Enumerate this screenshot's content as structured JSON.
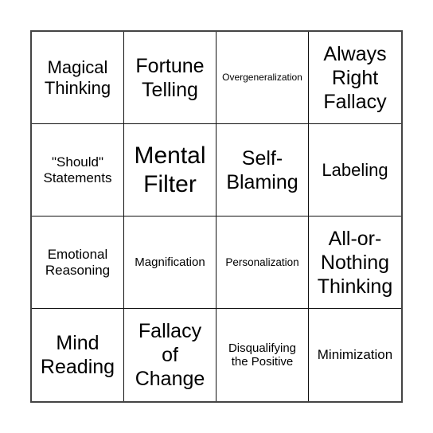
{
  "card": {
    "cells": [
      [
        "Magical Thinking",
        "Fortune Telling",
        "Overgeneralization",
        "Always Right Fallacy"
      ],
      [
        "\"Should\" Statements",
        "Mental Filter",
        "Self-Blaming",
        "Labeling"
      ],
      [
        "Emotional Reasoning",
        "Magnification",
        "Personalization",
        "All-or-Nothing Thinking"
      ],
      [
        "Mind Reading",
        "Fallacy of Change",
        "Disqualifying the Positive",
        "Minimization"
      ]
    ]
  },
  "lines": {
    "magical": [
      "Magical",
      "Thinking"
    ],
    "fortune": [
      "Fortune",
      "Telling"
    ],
    "overgen": [
      "Overgeneralization"
    ],
    "always": [
      "Always",
      "Right",
      "Fallacy"
    ],
    "should": [
      "\"Should\"",
      "Statements"
    ],
    "mental": [
      "Mental",
      "Filter"
    ],
    "self": [
      "Self-",
      "Blaming"
    ],
    "labeling": [
      "Labeling"
    ],
    "emotional": [
      "Emotional",
      "Reasoning"
    ],
    "magnification": [
      "Magnification"
    ],
    "personalization": [
      "Personalization"
    ],
    "allor": [
      "All-or-",
      "Nothing",
      "Thinking"
    ],
    "mind": [
      "Mind",
      "Reading"
    ],
    "fallacy": [
      "Fallacy",
      "of",
      "Change"
    ],
    "disq": [
      "Disqualifying",
      "the Positive"
    ],
    "minimization": [
      "Minimization"
    ]
  }
}
